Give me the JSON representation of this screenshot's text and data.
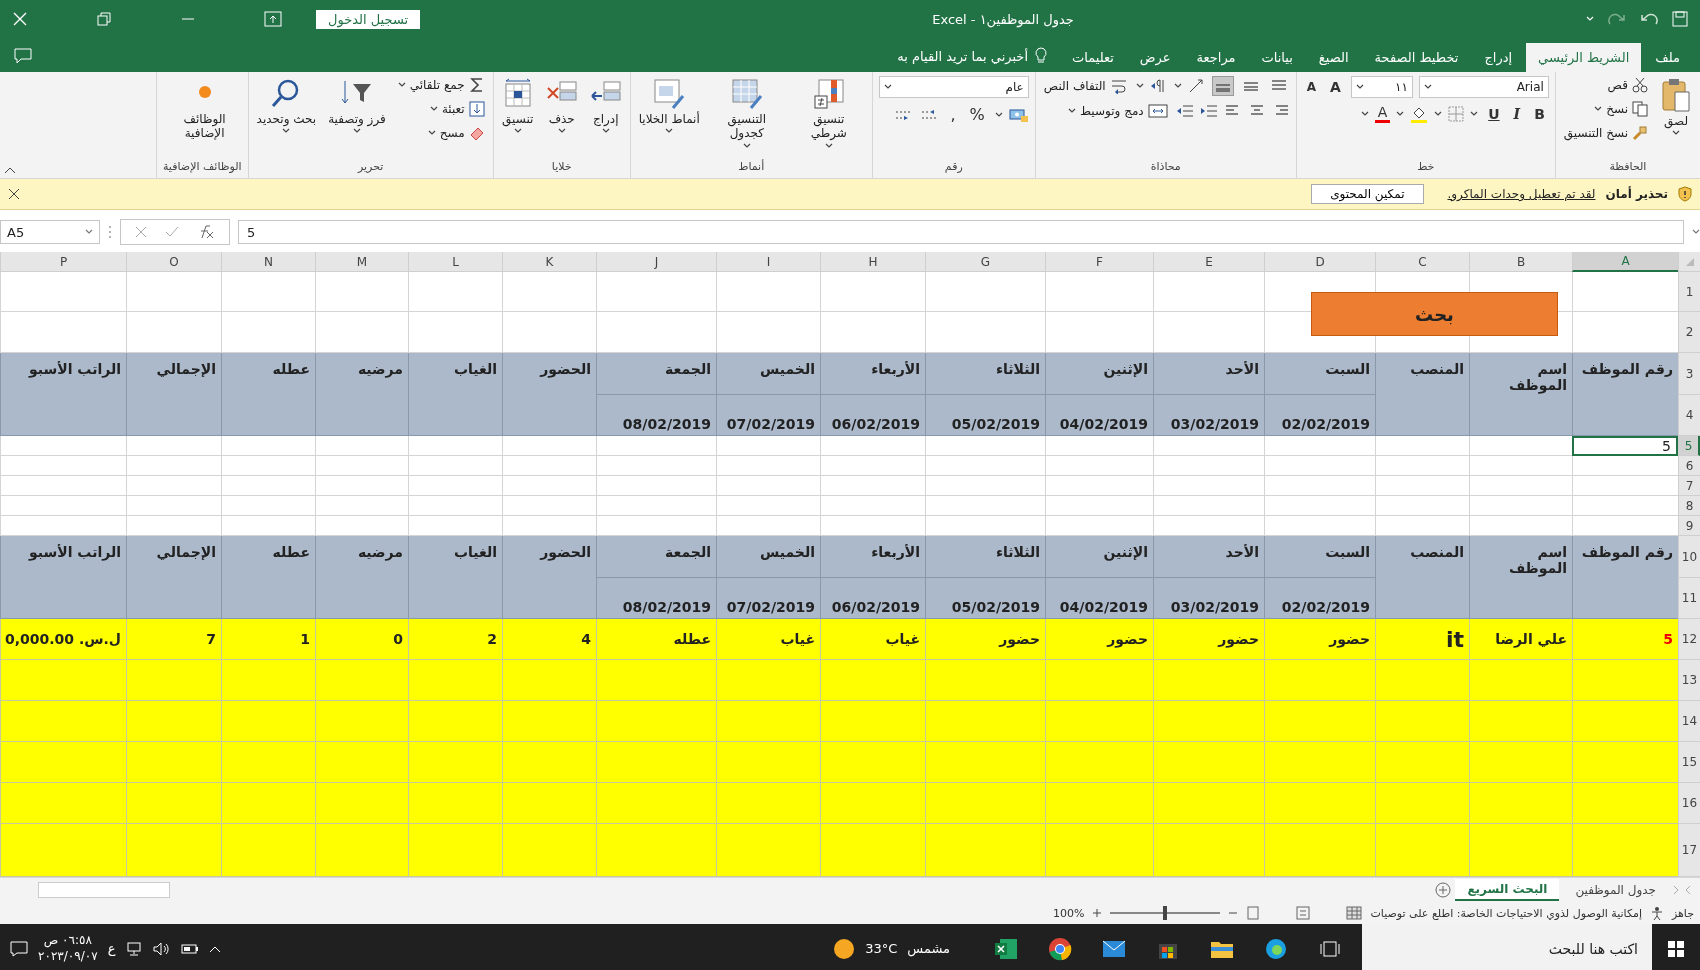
{
  "title_bar": {
    "title": "جدول الموظفين١  -  Excel",
    "sign_in": "تسجيل الدخول"
  },
  "tabs": [
    {
      "label": "ملف",
      "selected": false
    },
    {
      "label": "الشريط الرئيسي",
      "selected": true
    },
    {
      "label": "إدراج",
      "selected": false
    },
    {
      "label": "تخطيط الصفحة",
      "selected": false
    },
    {
      "label": "الصيغ",
      "selected": false
    },
    {
      "label": "بيانات",
      "selected": false
    },
    {
      "label": "مراجعة",
      "selected": false
    },
    {
      "label": "عرض",
      "selected": false
    },
    {
      "label": "تعليمات",
      "selected": false
    }
  ],
  "tell_me": "أخبرني بما تريد القيام به",
  "ribbon_groups": [
    {
      "kind": "clipboard",
      "label": "الحافظة",
      "items": [
        "لصق",
        "قص",
        "نسخ",
        "نسخ التنسيق"
      ]
    },
    {
      "kind": "font",
      "label": "خط",
      "font": "Arial",
      "size": "١١",
      "grow": "A",
      "shrink": "A",
      "styles": [
        "B",
        "I",
        "U"
      ],
      "font_color_button": "A"
    },
    {
      "kind": "alignment",
      "label": "محاذاة",
      "vertical": [
        {
          "on": false
        },
        {
          "on": false
        },
        {
          "on": true
        }
      ],
      "items": [
        "التفاف النص",
        "دمج وتوسيط"
      ]
    },
    {
      "kind": "number",
      "label": "رقم",
      "format": "عام",
      "symbols": [
        "%",
        ","
      ]
    },
    {
      "kind": "styles",
      "label": "أنماط",
      "items": [
        "تنسيق شرطي",
        "التنسيق كجدول",
        "أنماط الخلايا"
      ]
    },
    {
      "kind": "cells",
      "label": "خلايا",
      "items": [
        "إدراج",
        "حذف",
        "تنسيق"
      ]
    },
    {
      "kind": "editing",
      "label": "تحرير",
      "items": [
        "جمع تلقائي",
        "تعبئة",
        "مسح",
        "فرز وتصفية",
        "بحث وتحديد"
      ]
    },
    {
      "kind": "addins",
      "label": "الوظائف الإضافية",
      "items": [
        "الوظائف الإضافية"
      ]
    }
  ],
  "security_bar": {
    "title": "تحذير أمان",
    "message": "لقد تم تعطيل وحدات الماكرو.",
    "button": "تمكين المحتوى"
  },
  "formula_bar": {
    "name_box": "A5",
    "formula": "5"
  },
  "sheet": {
    "columns": [
      {
        "label": "A",
        "selected": true
      },
      {
        "label": "B",
        "selected": false
      },
      {
        "label": "C",
        "selected": false
      },
      {
        "label": "D",
        "selected": false
      },
      {
        "label": "E",
        "selected": false
      },
      {
        "label": "F",
        "selected": false
      },
      {
        "label": "G",
        "selected": false
      },
      {
        "label": "H",
        "selected": false
      },
      {
        "label": "I",
        "selected": false
      },
      {
        "label": "J",
        "selected": false
      },
      {
        "label": "K",
        "selected": false
      },
      {
        "label": "L",
        "selected": false
      },
      {
        "label": "M",
        "selected": false
      },
      {
        "label": "N",
        "selected": false
      },
      {
        "label": "O",
        "selected": false
      },
      {
        "label": "P",
        "selected": false
      }
    ],
    "rows": [
      {
        "label": "1",
        "selected": false
      },
      {
        "label": "2",
        "selected": false
      },
      {
        "label": "3",
        "selected": false
      },
      {
        "label": "4",
        "selected": false
      },
      {
        "label": "5",
        "selected": true
      },
      {
        "label": "6",
        "selected": false
      },
      {
        "label": "7",
        "selected": false
      },
      {
        "label": "8",
        "selected": false
      },
      {
        "label": "9",
        "selected": false
      },
      {
        "label": "10",
        "selected": false
      },
      {
        "label": "11",
        "selected": false
      },
      {
        "label": "12",
        "selected": false
      },
      {
        "label": "13",
        "selected": false
      },
      {
        "label": "14",
        "selected": false
      },
      {
        "label": "15",
        "selected": false
      },
      {
        "label": "16",
        "selected": false
      },
      {
        "label": "17",
        "selected": false
      }
    ],
    "blocks": [
      {
        "kind": "search",
        "button": "بحث"
      },
      {
        "kind": "header",
        "titles": [
          "رقم الموظف",
          "اسم الموظف",
          "المنصب",
          "السبت",
          "الأحد",
          "الإثنين",
          "الثلاثاء",
          "الأربعاء",
          "الخميس",
          "الجمعة",
          "الحضور",
          "الغياب",
          "مرضيه",
          "عطله",
          "الإجمالي",
          "الراتب الأسبو"
        ],
        "dates": [
          "02/02/2019",
          "03/02/2019",
          "04/02/2019",
          "05/02/2019",
          "06/02/2019",
          "07/02/2019",
          "08/02/2019"
        ]
      },
      {
        "kind": "entry",
        "cells": [
          {
            "text": "5",
            "selected": true
          }
        ]
      },
      {
        "kind": "blank"
      },
      {
        "kind": "blank"
      },
      {
        "kind": "blank"
      },
      {
        "kind": "blank"
      },
      {
        "kind": "header",
        "titles": [
          "رقم الموظف",
          "اسم الموظف",
          "المنصب",
          "السبت",
          "الأحد",
          "الإثنين",
          "الثلاثاء",
          "الأربعاء",
          "الخميس",
          "الجمعة",
          "الحضور",
          "الغياب",
          "مرضيه",
          "عطله",
          "الإجمالي",
          "الراتب الأسبو"
        ],
        "dates": [
          "02/02/2019",
          "03/02/2019",
          "04/02/2019",
          "05/02/2019",
          "06/02/2019",
          "07/02/2019",
          "08/02/2019"
        ]
      },
      {
        "kind": "data",
        "cells": [
          "5",
          "علي الرضا",
          "it",
          "حضور",
          "حضور",
          "حضور",
          "حضور",
          "غياب",
          "غياب",
          "عطله",
          "4",
          "2",
          "0",
          "1",
          "7",
          "ل.س. 0,000.00"
        ]
      },
      {
        "kind": "data"
      },
      {
        "kind": "data"
      },
      {
        "kind": "data"
      },
      {
        "kind": "data"
      },
      {
        "kind": "data"
      }
    ]
  },
  "sheet_tabs": [
    {
      "label": "جدول الموظفين",
      "selected": false
    },
    {
      "label": "البحث السريع",
      "selected": true
    }
  ],
  "status_bar": {
    "mode": "جاهز",
    "accessibility": "إمكانية الوصول لذوي الاحتياجات الخاصة: اطلع على توصيات",
    "zoom": {
      "reading": "100%",
      "level": 0.5
    }
  },
  "taskbar": {
    "search_placeholder": "اكتب هنا للبحث",
    "weather": {
      "temperature": "33°C",
      "condition": "مشمس"
    },
    "language": "ع",
    "time": "٠٦:٥٨ ص",
    "date": "٢٠٢٣/٠٩/٠٧"
  }
}
